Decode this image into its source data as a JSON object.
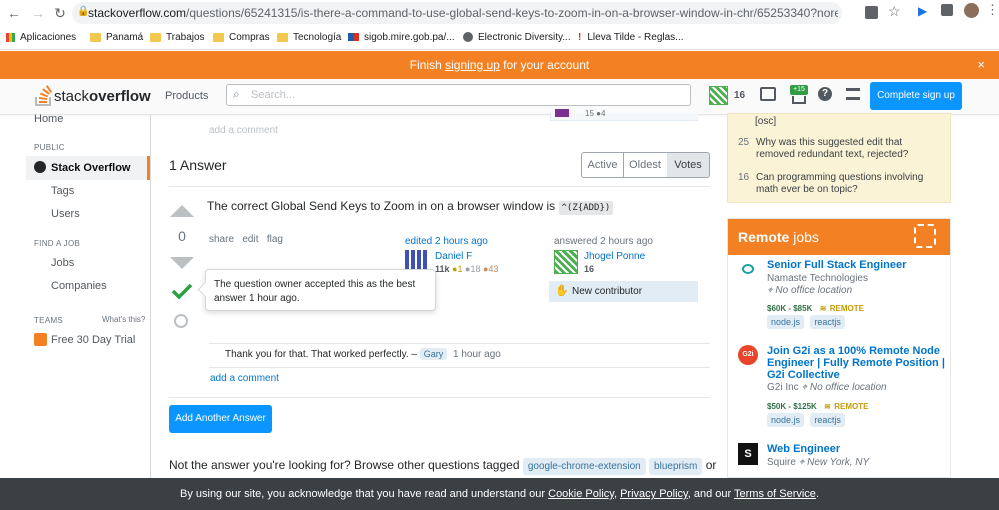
{
  "browser": {
    "url_main": "stackoverflow.com",
    "url_path": "/questions/65241315/is-there-a-command-to-use-global-send-keys-to-zoom-in-on-a-browser-window-in-chr/65253340?noredirect=1#comm...",
    "bookmarks": [
      "Aplicaciones",
      "Panamá",
      "Trabajos",
      "Compras",
      "Tecnología",
      "sigob.mire.gob.pa/...",
      "Electronic Diversity...",
      "Lleva Tilde - Reglas..."
    ]
  },
  "banner": {
    "pre": "Finish ",
    "link": "signing up",
    "post": " for your account",
    "close": "×"
  },
  "topbar": {
    "logo_a": "stack",
    "logo_b": "overflow",
    "products": "Products",
    "search_placeholder": "Search...",
    "rep": "16",
    "rep_badge": "+15",
    "signup": "Complete sign up"
  },
  "sidebar": {
    "home": "Home",
    "public": "PUBLIC",
    "stackoverflow": "Stack Overflow",
    "tags": "Tags",
    "users": "Users",
    "findjob": "FIND A JOB",
    "jobs": "Jobs",
    "companies": "Companies",
    "teams": "TEAMS",
    "whats": "What's this?",
    "trial": "Free 30 Day Trial"
  },
  "question": {
    "add_comment_top": "add a comment",
    "prev_votes": "15 ●4"
  },
  "answers": {
    "title": "1 Answer",
    "tabs": [
      "Active",
      "Oldest",
      "Votes"
    ]
  },
  "answer": {
    "score": "0",
    "body_text": "The correct Global Send Keys to Zoom in on a browser window is",
    "body_code": "^(Z{ADD})",
    "actions": [
      "share",
      "edit",
      "flag"
    ],
    "edited": "edited 2 hours ago",
    "editor_name": "Daniel F",
    "editor_rep": "11k",
    "editor_badges": [
      "●1",
      "●18",
      "●43"
    ],
    "answered": "answered 2 hours ago",
    "author_name": "Jhogel Ponne",
    "author_rep": "16",
    "new_contributor": "New contributor",
    "tooltip": "The question owner accepted this as the best answer 1 hour ago.",
    "comment_text": "Thank you for that. That worked perfectly. –",
    "comment_user": "Gary",
    "comment_time": "1 hour ago",
    "add_comment": "add a comment"
  },
  "add_answer_btn": "Add Another Answer",
  "not_answer": {
    "text": "Not the answer you're looking for? Browse other questions tagged",
    "tags": [
      "google-chrome-extension",
      "blueprism"
    ],
    "or": "or"
  },
  "related": {
    "top_text": "[osc]",
    "items": [
      {
        "score": "25",
        "text": "Why was this suggested edit that removed redundant text, rejected?"
      },
      {
        "score": "16",
        "text": "Can programming questions involving math ever be on topic?"
      }
    ]
  },
  "jobs": {
    "header_a": "Remote",
    "header_b": " jobs",
    "list": [
      {
        "title": "Senior Full Stack Engineer",
        "company": "Namaste Technologies",
        "loc": "No office location",
        "salary": "$60K - $85K",
        "remote": "REMOTE",
        "tags": [
          "node.js",
          "reactjs"
        ],
        "logo": ""
      },
      {
        "title": "Join G2i as a 100% Remote Node Engineer | Fully Remote Position | G2i Collective",
        "company": "G2i Inc",
        "loc": "No office location",
        "salary": "$50K - $125K",
        "remote": "REMOTE",
        "tags": [
          "node.js",
          "reactjs"
        ],
        "logo": "G2i"
      },
      {
        "title": "Web Engineer",
        "company": "Squire",
        "loc": "New York, NY",
        "logo": "S"
      }
    ]
  },
  "cookie": {
    "pre": "By using our site, you acknowledge that you have read and understand our ",
    "l1": "Cookie Policy",
    "sep1": ", ",
    "l2": "Privacy Policy",
    "sep2": ", and our ",
    "l3": "Terms of Service",
    "end": "."
  },
  "colors": {
    "accent": "#f48024",
    "link": "#0074cc",
    "accepted": "#2f9e44"
  }
}
